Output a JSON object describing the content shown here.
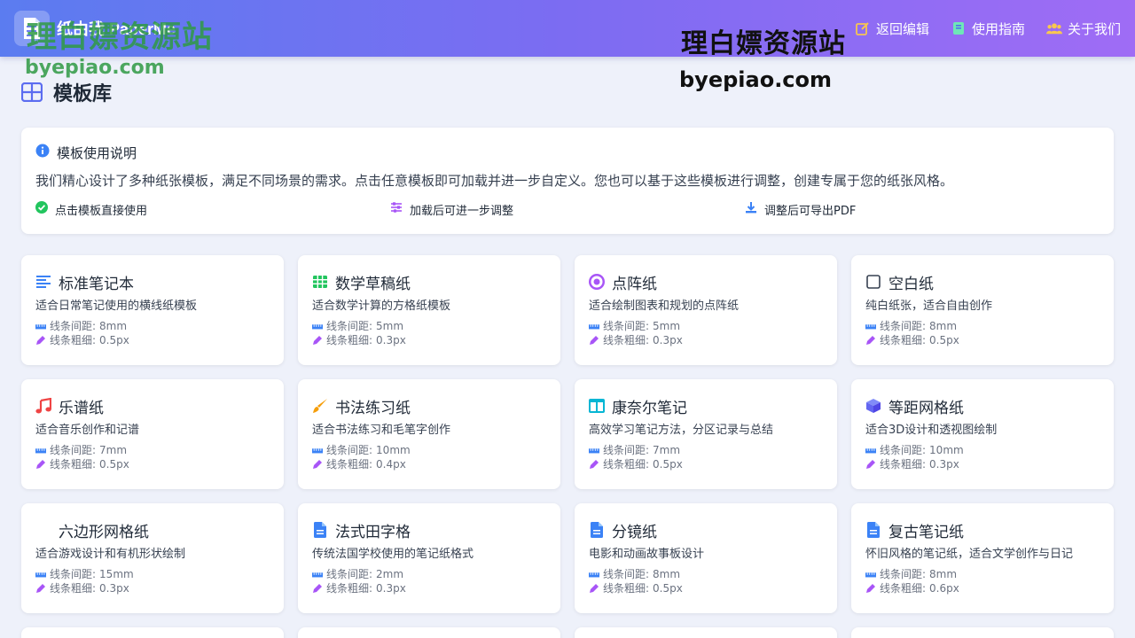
{
  "header": {
    "brand_name": "纸由我 PaperMe",
    "nav": [
      {
        "label": "返回编辑",
        "icon": "edit-icon"
      },
      {
        "label": "使用指南",
        "icon": "book-icon"
      },
      {
        "label": "关于我们",
        "icon": "users-icon"
      }
    ]
  },
  "watermarks": {
    "text_cn": "理白嫖资源站",
    "text_url": "byepiao.com"
  },
  "page": {
    "title": "模板库",
    "title_icon": "grid-icon"
  },
  "info": {
    "heading": "模板使用说明",
    "description": "我们精心设计了多种纸张模板，满足不同场景的需求。点击任意模板即可加载并进一步自定义。您也可以基于这些模板进行调整，创建专属于您的纸张风格。",
    "tips": [
      {
        "label": "点击模板直接使用",
        "icon": "check-circle-icon"
      },
      {
        "label": "加载后可进一步调整",
        "icon": "sliders-icon"
      },
      {
        "label": "调整后可导出PDF",
        "icon": "download-icon"
      }
    ]
  },
  "meta_labels": {
    "spacing": "线条间距:",
    "thickness": "线条粗细:"
  },
  "templates": [
    {
      "name": "标准笔记本",
      "desc": "适合日常笔记使用的横线纸模板",
      "spacing": "8mm",
      "thickness": "0.5px",
      "icon": "lines-icon",
      "color": "#3b82f6"
    },
    {
      "name": "数学草稿纸",
      "desc": "适合数学计算的方格纸模板",
      "spacing": "5mm",
      "thickness": "0.3px",
      "icon": "table-grid-icon",
      "color": "#22c55e"
    },
    {
      "name": "点阵纸",
      "desc": "适合绘制图表和规划的点阵纸",
      "spacing": "5mm",
      "thickness": "0.3px",
      "icon": "dot-circle-icon",
      "color": "#a855f7"
    },
    {
      "name": "空白纸",
      "desc": "纯白纸张，适合自由创作",
      "spacing": "8mm",
      "thickness": "0.5px",
      "icon": "square-outline-icon",
      "color": "#374151"
    },
    {
      "name": "乐谱纸",
      "desc": "适合音乐创作和记谱",
      "spacing": "7mm",
      "thickness": "0.5px",
      "icon": "music-note-icon",
      "color": "#ef4444"
    },
    {
      "name": "书法练习纸",
      "desc": "适合书法练习和毛笔字创作",
      "spacing": "10mm",
      "thickness": "0.4px",
      "icon": "brush-icon",
      "color": "#f59e0b"
    },
    {
      "name": "康奈尔笔记",
      "desc": "高效学习笔记方法，分区记录与总结",
      "spacing": "7mm",
      "thickness": "0.5px",
      "icon": "columns-icon",
      "color": "#06b6d4"
    },
    {
      "name": "等距网格纸",
      "desc": "适合3D设计和透视图绘制",
      "spacing": "10mm",
      "thickness": "0.3px",
      "icon": "cube-icon",
      "color": "#6366f1"
    },
    {
      "name": "六边形网格纸",
      "desc": "适合游戏设计和有机形状绘制",
      "spacing": "15mm",
      "thickness": "0.3px",
      "icon": "",
      "color": "#374151"
    },
    {
      "name": "法式田字格",
      "desc": "传统法国学校使用的笔记纸格式",
      "spacing": "2mm",
      "thickness": "0.3px",
      "icon": "file-icon",
      "color": "#3b82f6"
    },
    {
      "name": "分镜纸",
      "desc": "电影和动画故事板设计",
      "spacing": "8mm",
      "thickness": "0.5px",
      "icon": "file-icon",
      "color": "#3b82f6"
    },
    {
      "name": "复古笔记纸",
      "desc": "怀旧风格的笔记纸，适合文学创作与日记",
      "spacing": "8mm",
      "thickness": "0.6px",
      "icon": "file-icon",
      "color": "#3b82f6"
    }
  ],
  "colors": {
    "header_gradient_start": "#5b7cf0",
    "header_gradient_end": "#9f6cf5",
    "page_bg": "#eef1fa",
    "card_bg": "#ffffff",
    "meta_ruler_color": "#3b82f6",
    "meta_pen_color": "#a855f7"
  }
}
